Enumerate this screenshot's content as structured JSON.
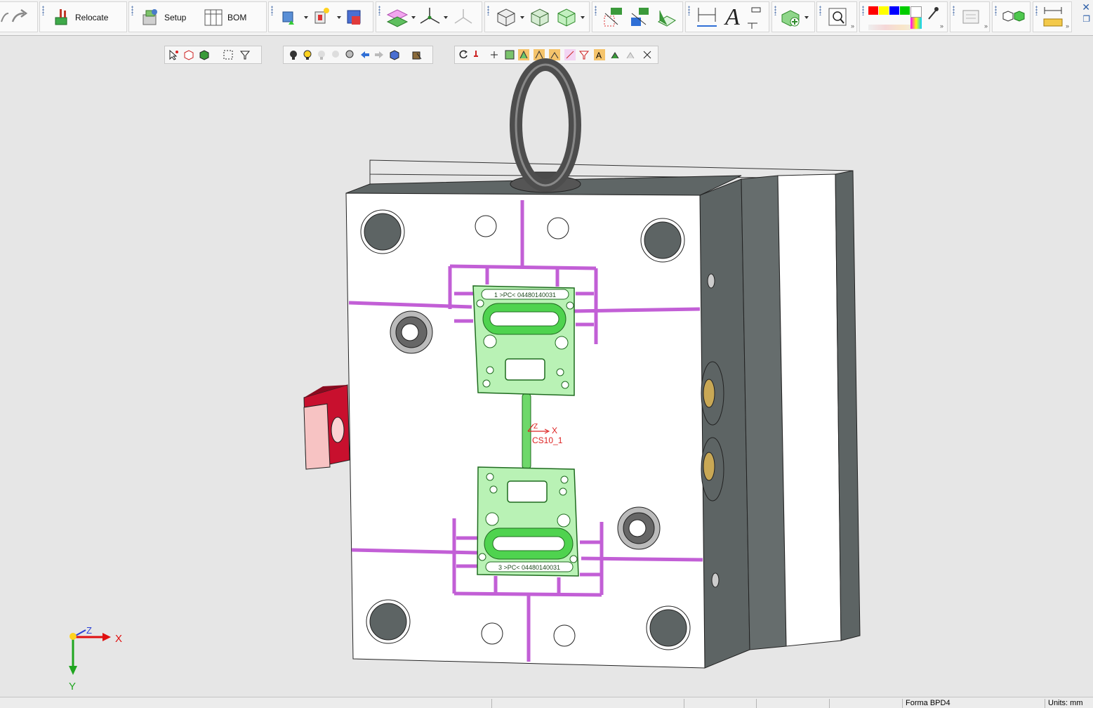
{
  "toolbar": {
    "relocate_label": "Relocate",
    "setup_label": "Setup",
    "bom_label": "BOM"
  },
  "colors": {
    "palette": [
      "#ff0000",
      "#ffff00",
      "#0000ff",
      "#00cc00",
      "#ffffff"
    ],
    "runner": "#c25fd6",
    "cavity": "#7ee87a",
    "plate": "#ffffff",
    "side": "#5b6262",
    "clamp": "#c8102e"
  },
  "viewport": {
    "csys_label": "CS10_1",
    "csys_x_label": "X",
    "csys_z_label": "Z",
    "triad": {
      "x_label": "X",
      "y_label": "Y",
      "z_label": "Z"
    },
    "cavity_top_text": "1 >PC< 04480140031",
    "cavity_bottom_text": "3 >PC< 04480140031"
  },
  "status": {
    "model_name": "Forma BPD4",
    "units": "Units: mm"
  },
  "icons": [
    "undo-icon",
    "redo-icon",
    "relocate-icon",
    "setup-icon",
    "bom-icon",
    "close-icon",
    "restore-icon",
    "eyedropper-icon",
    "dimension-icon",
    "text-icon"
  ]
}
